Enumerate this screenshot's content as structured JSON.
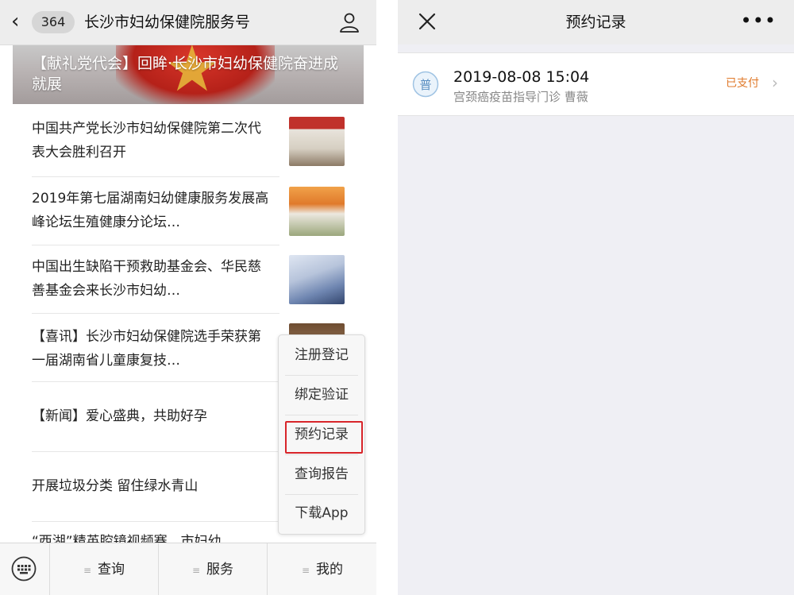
{
  "left_screen": {
    "nav": {
      "back_icon": "chevron-left-icon",
      "unread_count": "364",
      "title": "长沙市妇幼保健院服务号",
      "profile_icon": "person-icon"
    },
    "banner": {
      "title": "【献礼党代会】回眸·长沙市妇幼保健院奋进成就展"
    },
    "articles": [
      {
        "title": "中国共产党长沙市妇幼保健院第二次代表大会胜利召开"
      },
      {
        "title": "2019年第七届湖南妇幼健康服务发展高峰论坛生殖健康分论坛…"
      },
      {
        "title": "中国出生缺陷干预救助基金会、华民慈善基金会来长沙市妇幼…"
      },
      {
        "title": "【喜讯】长沙市妇幼保健院选手荣获第一届湖南省儿童康复技…"
      },
      {
        "title": "【新闻】爱心盛典，共助好孕"
      },
      {
        "title": "开展垃圾分类 留住绿水青山"
      },
      {
        "title": "“西湖”精英腔镜视频赛，市妇幼"
      }
    ],
    "popup_menu": {
      "items": [
        "注册登记",
        "绑定验证",
        "预约记录",
        "查询报告",
        "下载App"
      ],
      "highlighted_index": 2,
      "highlight_color": "#d8252a"
    },
    "tabbar": {
      "keyboard_icon": "keyboard-icon",
      "menu_icon": "≡",
      "tabs": [
        "查询",
        "服务",
        "我的"
      ]
    }
  },
  "right_screen": {
    "nav": {
      "close_icon": "close-icon",
      "title": "预约记录",
      "more_icon": "•••"
    },
    "records": [
      {
        "icon": "hospital-logo-icon",
        "icon_glyph": "普",
        "datetime": "2019-08-08 15:04",
        "detail": "宫颈癌疫苗指导门诊 曹薇",
        "status": "已支付",
        "status_color": "#e07a2b"
      }
    ]
  }
}
